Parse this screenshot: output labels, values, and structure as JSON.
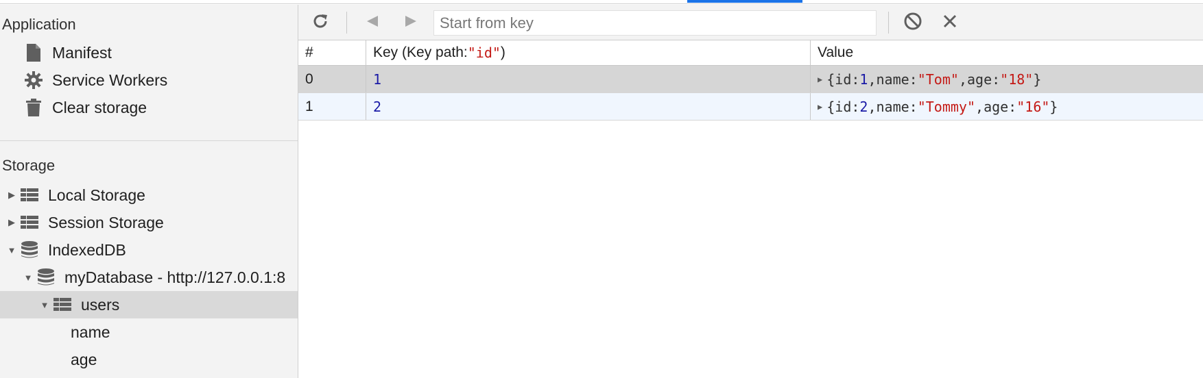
{
  "sidebar": {
    "application": {
      "title": "Application",
      "items": [
        {
          "label": "Manifest",
          "icon": "document-icon"
        },
        {
          "label": "Service Workers",
          "icon": "gear-icon"
        },
        {
          "label": "Clear storage",
          "icon": "trash-icon"
        }
      ]
    },
    "storage": {
      "title": "Storage",
      "items": [
        {
          "label": "Local Storage",
          "icon": "grid-icon",
          "expanded": false
        },
        {
          "label": "Session Storage",
          "icon": "grid-icon",
          "expanded": false
        },
        {
          "label": "IndexedDB",
          "icon": "database-icon",
          "expanded": true
        },
        {
          "label": "myDatabase - http://127.0.0.1:8",
          "icon": "database-icon",
          "expanded": true
        },
        {
          "label": "users",
          "icon": "grid-icon",
          "expanded": true,
          "selected": true
        },
        {
          "label": "name"
        },
        {
          "label": "age"
        }
      ]
    }
  },
  "toolbar": {
    "search_placeholder": "Start from key"
  },
  "table": {
    "headers": {
      "num": "#",
      "key_prefix": "Key (Key path: ",
      "key_path": "\"id\"",
      "key_suffix": ")",
      "value": "Value"
    },
    "rows": [
      {
        "index": "0",
        "key": "1",
        "value": {
          "open": "{",
          "id_label": "id: ",
          "id": "1",
          "sep1": ", ",
          "name_label": "name: ",
          "name": "\"Tom\"",
          "sep2": ", ",
          "age_label": "age: ",
          "age": "\"18\"",
          "close": "}"
        }
      },
      {
        "index": "1",
        "key": "2",
        "value": {
          "open": "{",
          "id_label": "id: ",
          "id": "2",
          "sep1": ", ",
          "name_label": "name: ",
          "name": "\"Tommy\"",
          "sep2": ", ",
          "age_label": "age: ",
          "age": "\"16\"",
          "close": "}"
        }
      }
    ]
  },
  "colors": {
    "accent": "#1a73e8",
    "number": "#1a1aa6",
    "string": "#c41a16",
    "selected_row": "#d6d6d6",
    "alt_row": "#f0f6fe"
  }
}
